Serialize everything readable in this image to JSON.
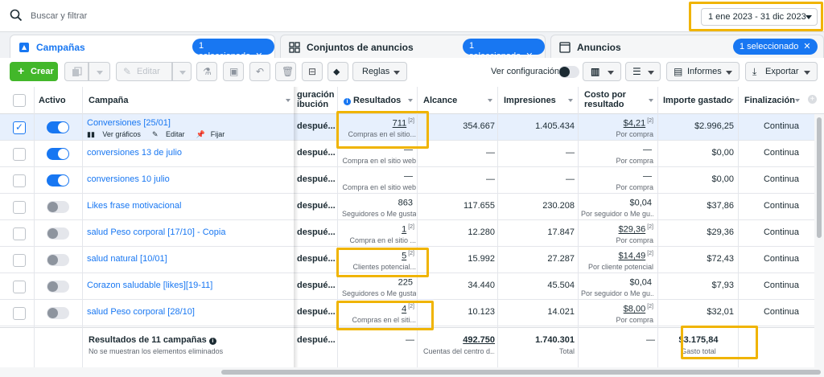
{
  "search": {
    "placeholder": "Buscar y filtrar"
  },
  "date_range": "1 ene 2023 - 31 dic 2023",
  "tabs": [
    {
      "label": "Campañas",
      "chip": "1 seleccionado"
    },
    {
      "label": "Conjuntos de anuncios",
      "chip": "1 seleccionado"
    },
    {
      "label": "Anuncios",
      "chip": "1 seleccionado"
    }
  ],
  "toolbar": {
    "create": "Crear",
    "edit": "Editar",
    "rules": "Reglas",
    "view_config": "Ver configuración",
    "reports": "Informes",
    "export": "Exportar"
  },
  "columns": {
    "active": "Activo",
    "campaign": "Campaña",
    "attribution_1": "guración",
    "attribution_2": "ibución",
    "results": "Resultados",
    "reach": "Alcance",
    "impressions": "Impresiones",
    "cost_1": "Costo por",
    "cost_2": "resultado",
    "spent": "Importe gastado",
    "end": "Finalización"
  },
  "row_actions": {
    "charts": "Ver gráficos",
    "edit": "Editar",
    "pin": "Fijar"
  },
  "rows": [
    {
      "name": "Conversiones [25/01]",
      "active": true,
      "selected": true,
      "attribution": "despué...",
      "result": "711",
      "result_sup": "[2]",
      "result_label": "Compras en el sitio...",
      "reach": "354.667",
      "impressions": "1.405.434",
      "cost": "$4,21",
      "cost_sup": "[2]",
      "cost_label": "Por compra",
      "spent": "$2.996,25",
      "end": "Continua"
    },
    {
      "name": "conversiones 13 de julio",
      "active": true,
      "selected": false,
      "attribution": "despué...",
      "result": "—",
      "result_sup": "",
      "result_label": "Compra en el sitio web",
      "reach": "—",
      "impressions": "—",
      "cost": "—",
      "cost_sup": "",
      "cost_label": "Por compra",
      "spent": "$0,00",
      "end": "Continua"
    },
    {
      "name": "conversiones 10 julio",
      "active": true,
      "selected": false,
      "attribution": "despué...",
      "result": "—",
      "result_sup": "",
      "result_label": "Compra en el sitio web",
      "reach": "—",
      "impressions": "—",
      "cost": "—",
      "cost_sup": "",
      "cost_label": "Por compra",
      "spent": "$0,00",
      "end": "Continua"
    },
    {
      "name": "Likes frase motivacional",
      "active": false,
      "selected": false,
      "attribution": "despué...",
      "result": "863",
      "result_sup": "",
      "result_label": "Seguidores o Me gusta",
      "reach": "117.655",
      "impressions": "230.208",
      "cost": "$0,04",
      "cost_sup": "",
      "cost_label": "Por seguidor o Me gu...",
      "spent": "$37,86",
      "end": "Continua"
    },
    {
      "name": "salud Peso corporal [17/10] - Copia",
      "active": false,
      "selected": false,
      "attribution": "despué...",
      "result": "1",
      "result_sup": "[2]",
      "result_label": "Compra en el sitio ...",
      "reach": "12.280",
      "impressions": "17.847",
      "cost": "$29,36",
      "cost_sup": "[2]",
      "cost_label": "Por compra",
      "spent": "$29,36",
      "end": "Continua"
    },
    {
      "name": "salud natural [10/01]",
      "active": false,
      "selected": false,
      "attribution": "despué...",
      "result": "5",
      "result_sup": "[2]",
      "result_label": "Clientes potencial...",
      "reach": "15.992",
      "impressions": "27.287",
      "cost": "$14,49",
      "cost_sup": "[2]",
      "cost_label": "Por cliente potencial",
      "spent": "$72,43",
      "end": "Continua"
    },
    {
      "name": "Corazon saludable [likes][19-11]",
      "active": false,
      "selected": false,
      "attribution": "despué...",
      "result": "225",
      "result_sup": "",
      "result_label": "Seguidores o Me gusta",
      "reach": "34.440",
      "impressions": "45.504",
      "cost": "$0,04",
      "cost_sup": "",
      "cost_label": "Por seguidor o Me gu...",
      "spent": "$7,93",
      "end": "Continua"
    },
    {
      "name": "salud Peso corporal [28/10]",
      "active": false,
      "selected": false,
      "attribution": "despué...",
      "result": "4",
      "result_sup": "[2]",
      "result_label": "Compras en el siti...",
      "reach": "10.123",
      "impressions": "14.021",
      "cost": "$8,00",
      "cost_sup": "[2]",
      "cost_label": "Por compra",
      "spent": "$32,01",
      "end": "Continua"
    }
  ],
  "summary": {
    "title": "Resultados de 11 campañas",
    "note": "No se muestran los elementos eliminados",
    "attribution": "despué...",
    "result": "—",
    "reach": "492.750",
    "reach_label": "Cuentas del centro d...",
    "impressions": "1.740.301",
    "impressions_label": "Total",
    "cost": "—",
    "spent": "$3.175,84",
    "spent_label": "Gasto total"
  },
  "colors": {
    "accent": "#1877f2",
    "create": "#42b72a",
    "highlight": "#f0b400"
  }
}
